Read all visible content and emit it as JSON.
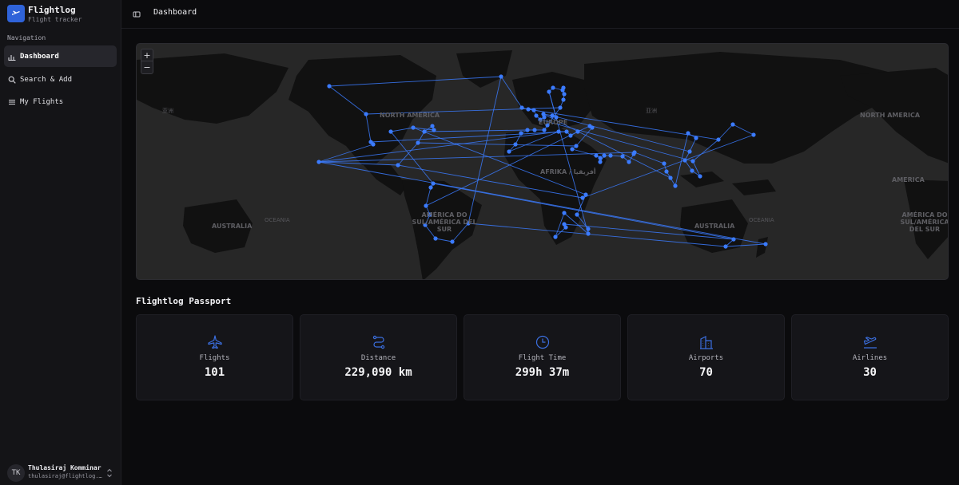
{
  "app": {
    "name": "Flightlog",
    "tagline": "Flight tracker"
  },
  "sidebar": {
    "heading": "Navigation",
    "items": [
      {
        "label": "Dashboard",
        "icon": "chart-icon",
        "active": true
      },
      {
        "label": "Search & Add",
        "icon": "search-icon",
        "active": false
      },
      {
        "label": "My Flights",
        "icon": "list-icon",
        "active": false
      }
    ]
  },
  "user": {
    "initials": "TK",
    "name": "Thulasiraj Komminar",
    "email": "thulasiraj@flightlog.app"
  },
  "header": {
    "title": "Dashboard"
  },
  "map": {
    "zoom_in": "+",
    "zoom_out": "−",
    "labels": {
      "north_america_left": "NORTH AMERICA",
      "north_america_right": "NORTH AMERICA",
      "south_america": "AMÉRICA DO SUL/AMÉRICA DEL SUR",
      "south_america_right": "AMÉRICA DO SUL/AMÉRICA DEL SUR",
      "america_right": "AMERICA",
      "africa": "AFRIKA / أفريقيا",
      "europe": "EUROPE",
      "australia_left": "AUSTRALIA",
      "australia_right": "AUSTRALIA",
      "oceania_left": "OCEANIA",
      "oceania_right": "OCEANIA",
      "asia_left": "亚洲",
      "asia_right": "亚洲"
    },
    "route_color": "#3b7bff",
    "land_color": "#111111",
    "sea_color": "#272727"
  },
  "passport": {
    "title": "Flightlog Passport",
    "accent": "#3b6fe0",
    "stats": [
      {
        "label": "Flights",
        "value": "101",
        "icon": "plane-icon"
      },
      {
        "label": "Distance",
        "value": "229,090 km",
        "icon": "route-icon"
      },
      {
        "label": "Flight Time",
        "value": "299h 37m",
        "icon": "clock-icon"
      },
      {
        "label": "Airports",
        "value": "70",
        "icon": "building-icon"
      },
      {
        "label": "Airlines",
        "value": "30",
        "icon": "departure-icon"
      }
    ]
  }
}
